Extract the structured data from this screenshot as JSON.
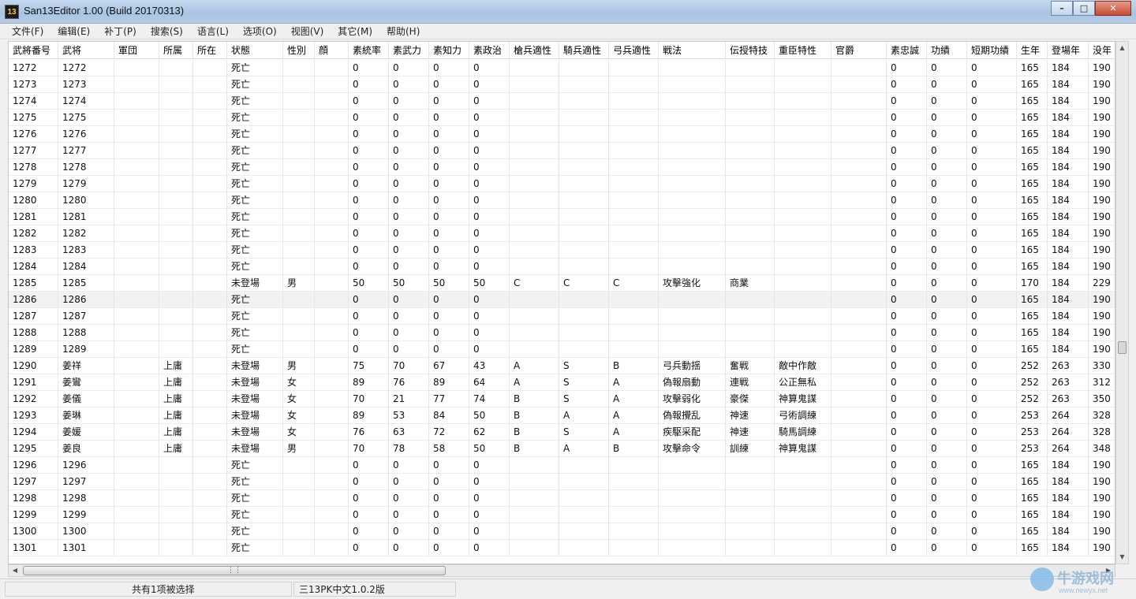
{
  "window": {
    "title": "San13Editor 1.00 (Build 20170313)",
    "icon_label": "13"
  },
  "menu": [
    "文件(F)",
    "编辑(E)",
    "补丁(P)",
    "搜索(S)",
    "语言(L)",
    "选项(O)",
    "视图(V)",
    "其它(M)",
    "帮助(H)"
  ],
  "columns": [
    "武將番号",
    "武将",
    "軍団",
    "所属",
    "所在",
    "状態",
    "性別",
    "顔",
    "素統率",
    "素武力",
    "素知力",
    "素政治",
    "槍兵適性",
    "騎兵適性",
    "弓兵適性",
    "戦法",
    "伝授特技",
    "重臣特性",
    "官爵",
    "素忠誠",
    "功績",
    "短期功績",
    "生年",
    "登場年",
    "没年"
  ],
  "rows": [
    [
      "1272",
      "1272",
      "",
      "",
      "",
      "死亡",
      "",
      "",
      "0",
      "0",
      "0",
      "0",
      "",
      "",
      "",
      "",
      "",
      "",
      "",
      "0",
      "0",
      "0",
      "165",
      "184",
      "190"
    ],
    [
      "1273",
      "1273",
      "",
      "",
      "",
      "死亡",
      "",
      "",
      "0",
      "0",
      "0",
      "0",
      "",
      "",
      "",
      "",
      "",
      "",
      "",
      "0",
      "0",
      "0",
      "165",
      "184",
      "190"
    ],
    [
      "1274",
      "1274",
      "",
      "",
      "",
      "死亡",
      "",
      "",
      "0",
      "0",
      "0",
      "0",
      "",
      "",
      "",
      "",
      "",
      "",
      "",
      "0",
      "0",
      "0",
      "165",
      "184",
      "190"
    ],
    [
      "1275",
      "1275",
      "",
      "",
      "",
      "死亡",
      "",
      "",
      "0",
      "0",
      "0",
      "0",
      "",
      "",
      "",
      "",
      "",
      "",
      "",
      "0",
      "0",
      "0",
      "165",
      "184",
      "190"
    ],
    [
      "1276",
      "1276",
      "",
      "",
      "",
      "死亡",
      "",
      "",
      "0",
      "0",
      "0",
      "0",
      "",
      "",
      "",
      "",
      "",
      "",
      "",
      "0",
      "0",
      "0",
      "165",
      "184",
      "190"
    ],
    [
      "1277",
      "1277",
      "",
      "",
      "",
      "死亡",
      "",
      "",
      "0",
      "0",
      "0",
      "0",
      "",
      "",
      "",
      "",
      "",
      "",
      "",
      "0",
      "0",
      "0",
      "165",
      "184",
      "190"
    ],
    [
      "1278",
      "1278",
      "",
      "",
      "",
      "死亡",
      "",
      "",
      "0",
      "0",
      "0",
      "0",
      "",
      "",
      "",
      "",
      "",
      "",
      "",
      "0",
      "0",
      "0",
      "165",
      "184",
      "190"
    ],
    [
      "1279",
      "1279",
      "",
      "",
      "",
      "死亡",
      "",
      "",
      "0",
      "0",
      "0",
      "0",
      "",
      "",
      "",
      "",
      "",
      "",
      "",
      "0",
      "0",
      "0",
      "165",
      "184",
      "190"
    ],
    [
      "1280",
      "1280",
      "",
      "",
      "",
      "死亡",
      "",
      "",
      "0",
      "0",
      "0",
      "0",
      "",
      "",
      "",
      "",
      "",
      "",
      "",
      "0",
      "0",
      "0",
      "165",
      "184",
      "190"
    ],
    [
      "1281",
      "1281",
      "",
      "",
      "",
      "死亡",
      "",
      "",
      "0",
      "0",
      "0",
      "0",
      "",
      "",
      "",
      "",
      "",
      "",
      "",
      "0",
      "0",
      "0",
      "165",
      "184",
      "190"
    ],
    [
      "1282",
      "1282",
      "",
      "",
      "",
      "死亡",
      "",
      "",
      "0",
      "0",
      "0",
      "0",
      "",
      "",
      "",
      "",
      "",
      "",
      "",
      "0",
      "0",
      "0",
      "165",
      "184",
      "190"
    ],
    [
      "1283",
      "1283",
      "",
      "",
      "",
      "死亡",
      "",
      "",
      "0",
      "0",
      "0",
      "0",
      "",
      "",
      "",
      "",
      "",
      "",
      "",
      "0",
      "0",
      "0",
      "165",
      "184",
      "190"
    ],
    [
      "1284",
      "1284",
      "",
      "",
      "",
      "死亡",
      "",
      "",
      "0",
      "0",
      "0",
      "0",
      "",
      "",
      "",
      "",
      "",
      "",
      "",
      "0",
      "0",
      "0",
      "165",
      "184",
      "190"
    ],
    [
      "1285",
      "1285",
      "",
      "",
      "",
      "未登場",
      "男",
      "",
      "50",
      "50",
      "50",
      "50",
      "C",
      "C",
      "C",
      "攻擊強化",
      "商業",
      "",
      "",
      "0",
      "0",
      "0",
      "170",
      "184",
      "229"
    ],
    [
      "1286",
      "1286",
      "",
      "",
      "",
      "死亡",
      "",
      "",
      "0",
      "0",
      "0",
      "0",
      "",
      "",
      "",
      "",
      "",
      "",
      "",
      "0",
      "0",
      "0",
      "165",
      "184",
      "190"
    ],
    [
      "1287",
      "1287",
      "",
      "",
      "",
      "死亡",
      "",
      "",
      "0",
      "0",
      "0",
      "0",
      "",
      "",
      "",
      "",
      "",
      "",
      "",
      "0",
      "0",
      "0",
      "165",
      "184",
      "190"
    ],
    [
      "1288",
      "1288",
      "",
      "",
      "",
      "死亡",
      "",
      "",
      "0",
      "0",
      "0",
      "0",
      "",
      "",
      "",
      "",
      "",
      "",
      "",
      "0",
      "0",
      "0",
      "165",
      "184",
      "190"
    ],
    [
      "1289",
      "1289",
      "",
      "",
      "",
      "死亡",
      "",
      "",
      "0",
      "0",
      "0",
      "0",
      "",
      "",
      "",
      "",
      "",
      "",
      "",
      "0",
      "0",
      "0",
      "165",
      "184",
      "190"
    ],
    [
      "1290",
      "姜祥",
      "",
      "上庸",
      "",
      "未登場",
      "男",
      "",
      "75",
      "70",
      "67",
      "43",
      "A",
      "S",
      "B",
      "弓兵動揺",
      "奮戦",
      "敵中作敵",
      "",
      "0",
      "0",
      "0",
      "252",
      "263",
      "330"
    ],
    [
      "1291",
      "姜鸞",
      "",
      "上庸",
      "",
      "未登場",
      "女",
      "",
      "89",
      "76",
      "89",
      "64",
      "A",
      "S",
      "A",
      "偽報扇動",
      "連戦",
      "公正無私",
      "",
      "0",
      "0",
      "0",
      "252",
      "263",
      "312"
    ],
    [
      "1292",
      "姜儀",
      "",
      "上庸",
      "",
      "未登場",
      "女",
      "",
      "70",
      "21",
      "77",
      "74",
      "B",
      "S",
      "A",
      "攻擊弱化",
      "豪傑",
      "神算鬼謀",
      "",
      "0",
      "0",
      "0",
      "252",
      "263",
      "350"
    ],
    [
      "1293",
      "姜琳",
      "",
      "上庸",
      "",
      "未登場",
      "女",
      "",
      "89",
      "53",
      "84",
      "50",
      "B",
      "A",
      "A",
      "偽報攪乱",
      "神速",
      "弓術調練",
      "",
      "0",
      "0",
      "0",
      "253",
      "264",
      "328"
    ],
    [
      "1294",
      "姜媛",
      "",
      "上庸",
      "",
      "未登場",
      "女",
      "",
      "76",
      "63",
      "72",
      "62",
      "B",
      "S",
      "A",
      "疾駆采配",
      "神速",
      "騎馬調練",
      "",
      "0",
      "0",
      "0",
      "253",
      "264",
      "328"
    ],
    [
      "1295",
      "姜良",
      "",
      "上庸",
      "",
      "未登場",
      "男",
      "",
      "70",
      "78",
      "58",
      "50",
      "B",
      "A",
      "B",
      "攻擊命令",
      "訓練",
      "神算鬼謀",
      "",
      "0",
      "0",
      "0",
      "253",
      "264",
      "348"
    ],
    [
      "1296",
      "1296",
      "",
      "",
      "",
      "死亡",
      "",
      "",
      "0",
      "0",
      "0",
      "0",
      "",
      "",
      "",
      "",
      "",
      "",
      "",
      "0",
      "0",
      "0",
      "165",
      "184",
      "190"
    ],
    [
      "1297",
      "1297",
      "",
      "",
      "",
      "死亡",
      "",
      "",
      "0",
      "0",
      "0",
      "0",
      "",
      "",
      "",
      "",
      "",
      "",
      "",
      "0",
      "0",
      "0",
      "165",
      "184",
      "190"
    ],
    [
      "1298",
      "1298",
      "",
      "",
      "",
      "死亡",
      "",
      "",
      "0",
      "0",
      "0",
      "0",
      "",
      "",
      "",
      "",
      "",
      "",
      "",
      "0",
      "0",
      "0",
      "165",
      "184",
      "190"
    ],
    [
      "1299",
      "1299",
      "",
      "",
      "",
      "死亡",
      "",
      "",
      "0",
      "0",
      "0",
      "0",
      "",
      "",
      "",
      "",
      "",
      "",
      "",
      "0",
      "0",
      "0",
      "165",
      "184",
      "190"
    ],
    [
      "1300",
      "1300",
      "",
      "",
      "",
      "死亡",
      "",
      "",
      "0",
      "0",
      "0",
      "0",
      "",
      "",
      "",
      "",
      "",
      "",
      "",
      "0",
      "0",
      "0",
      "165",
      "184",
      "190"
    ],
    [
      "1301",
      "1301",
      "",
      "",
      "",
      "死亡",
      "",
      "",
      "0",
      "0",
      "0",
      "0",
      "",
      "",
      "",
      "",
      "",
      "",
      "",
      "0",
      "0",
      "0",
      "165",
      "184",
      "190"
    ]
  ],
  "selected_row": "1286",
  "status": {
    "selection": "共有1项被选择",
    "version": "三13PK中文1.0.2版"
  },
  "watermark": {
    "text": "牛游戏网",
    "url": "www.newyx.net"
  }
}
